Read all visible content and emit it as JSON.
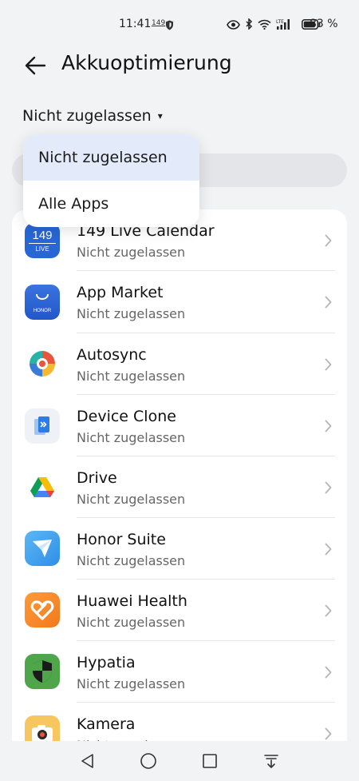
{
  "status_bar": {
    "time": "11:41",
    "small_label": "149",
    "battery_text": "83 %",
    "icons": [
      "eye-icon",
      "bluetooth-icon",
      "wifi-icon",
      "lte-signal-icon",
      "battery-icon"
    ]
  },
  "header": {
    "title": "Akkuoptimierung",
    "back_icon": "arrow-left-icon"
  },
  "filter": {
    "label": "Nicht zugelassen",
    "caret": "▾"
  },
  "dropdown": {
    "items": [
      {
        "label": "Nicht zugelassen",
        "selected": true
      },
      {
        "label": "Alle Apps",
        "selected": false
      }
    ]
  },
  "apps": [
    {
      "name": "149 Live Calendar",
      "status": "Nicht zugelassen",
      "icon": "calendar-149-icon",
      "icon_text_top": "149",
      "icon_text_bottom": "LIVE"
    },
    {
      "name": "App Market",
      "status": "Nicht zugelassen",
      "icon": "app-market-icon",
      "icon_text_bottom": "HONOR"
    },
    {
      "name": "Autosync",
      "status": "Nicht zugelassen",
      "icon": "autosync-icon"
    },
    {
      "name": "Device Clone",
      "status": "Nicht zugelassen",
      "icon": "device-clone-icon"
    },
    {
      "name": "Drive",
      "status": "Nicht zugelassen",
      "icon": "drive-icon"
    },
    {
      "name": "Honor Suite",
      "status": "Nicht zugelassen",
      "icon": "honor-suite-icon"
    },
    {
      "name": "Huawei Health",
      "status": "Nicht zugelassen",
      "icon": "huawei-health-icon"
    },
    {
      "name": "Hypatia",
      "status": "Nicht zugelassen",
      "icon": "hypatia-icon"
    },
    {
      "name": "Kamera",
      "status": "Nicht zugelassen",
      "icon": "camera-icon"
    }
  ],
  "navbar": {
    "icons": [
      "back-triangle-icon",
      "home-circle-icon",
      "recents-square-icon",
      "notification-drawer-icon"
    ]
  },
  "colors": {
    "background": "#f1f3f5",
    "card": "#ffffff",
    "selected_bg": "#e3ebfb",
    "secondary_text": "#666666"
  }
}
